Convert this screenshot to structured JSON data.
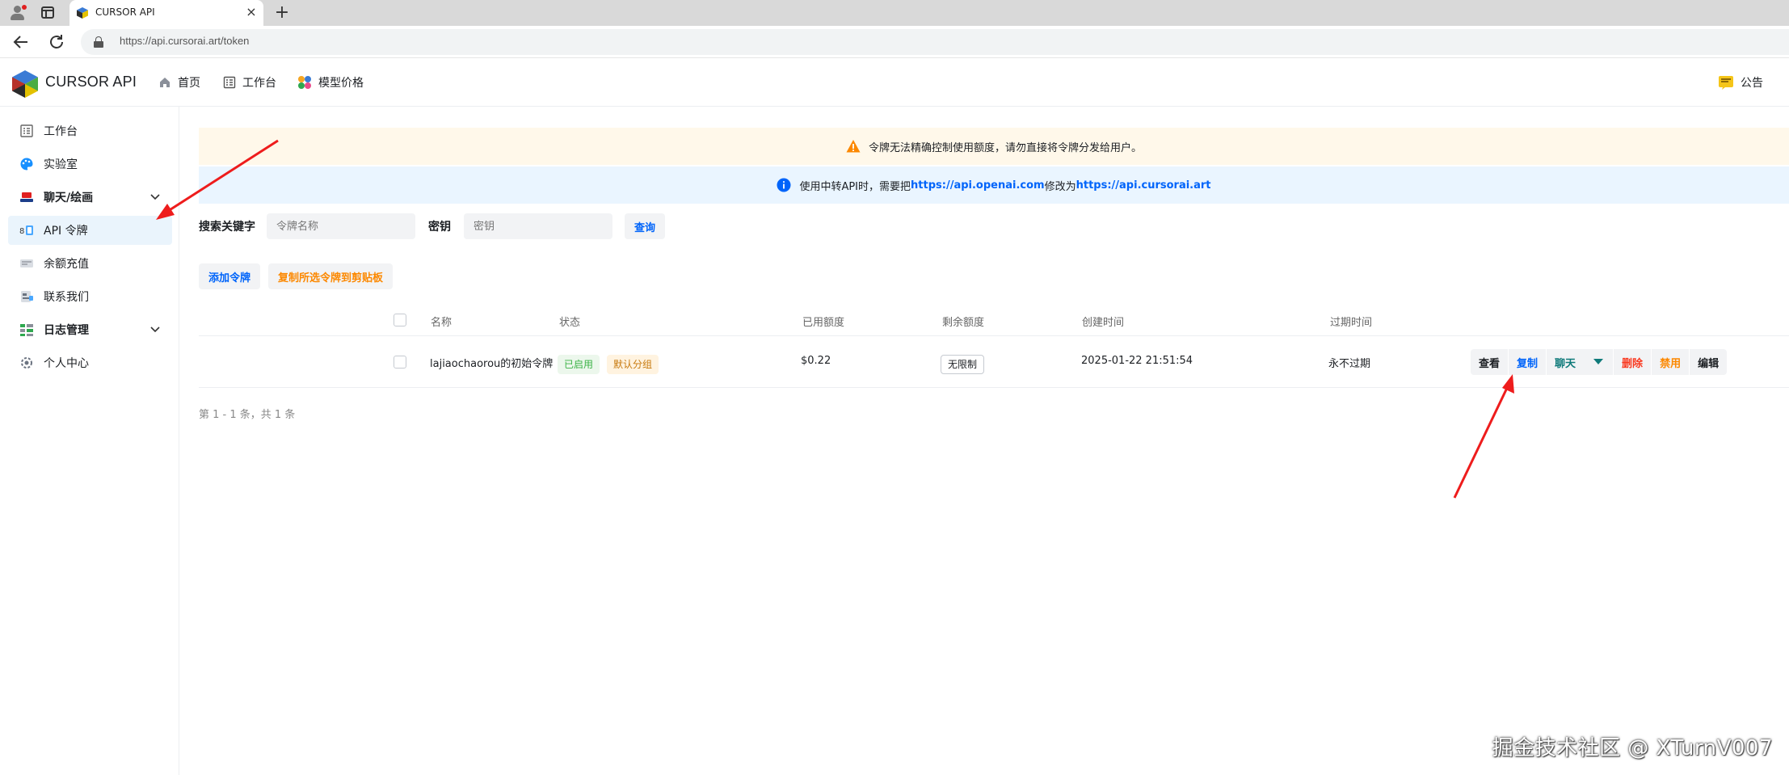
{
  "browser": {
    "tab_title": "CURSOR API",
    "tab_close": "×",
    "new_tab": "+",
    "url": "https://api.cursorai.art/token"
  },
  "header": {
    "brand": "CURSOR API",
    "nav": [
      {
        "label": "首页",
        "icon": "home-icon"
      },
      {
        "label": "工作台",
        "icon": "dashboard-icon"
      },
      {
        "label": "模型价格",
        "icon": "price-icon"
      }
    ],
    "announcement": "公告"
  },
  "sidebar": {
    "items": [
      {
        "label": "工作台",
        "icon": "dashboard-icon"
      },
      {
        "label": "实验室",
        "icon": "palette-icon"
      },
      {
        "label": "聊天/绘画",
        "icon": "chat-icon",
        "expandable": true
      },
      {
        "label": "API 令牌",
        "icon": "token-icon",
        "active": true
      },
      {
        "label": "余额充值",
        "icon": "wallet-icon"
      },
      {
        "label": "联系我们",
        "icon": "contact-icon"
      },
      {
        "label": "日志管理",
        "icon": "log-icon",
        "expandable": true
      },
      {
        "label": "个人中心",
        "icon": "user-icon"
      }
    ]
  },
  "banners": {
    "warning": "令牌无法精确控制使用额度，请勿直接将令牌分发给用户。",
    "info_prefix": "使用中转API时，需要把",
    "info_link1": "https://api.openai.com",
    "info_middle": "修改为",
    "info_link2": "https://api.cursorai.art"
  },
  "search": {
    "keyword_label": "搜索关键字",
    "keyword_placeholder": "令牌名称",
    "key_label": "密钥",
    "key_placeholder": "密钥",
    "query_button": "查询"
  },
  "actions": {
    "add_token": "添加令牌",
    "copy_selected": "复制所选令牌到剪贴板"
  },
  "table": {
    "columns": [
      "名称",
      "状态",
      "已用额度",
      "剩余额度",
      "创建时间",
      "过期时间"
    ],
    "rows": [
      {
        "name": "lajiaochaorou的初始令牌",
        "status": "已启用",
        "group": "默认分组",
        "used": "$0.22",
        "remaining": "无限制",
        "created": "2025-01-22 21:51:54",
        "expires": "永不过期",
        "ops": {
          "view": "查看",
          "copy": "复制",
          "chat": "聊天",
          "delete": "删除",
          "disable": "禁用",
          "edit": "编辑"
        }
      }
    ]
  },
  "pager": {
    "summary": "第 1 - 1 条，共 1 条"
  },
  "watermark": "掘金技术社区 @ XTurnV007",
  "colors": {
    "primary": "#0064fa",
    "warning": "#fc8800",
    "danger": "#f93920",
    "teal": "#0f7a7a",
    "arrow": "#ee1c1c"
  }
}
